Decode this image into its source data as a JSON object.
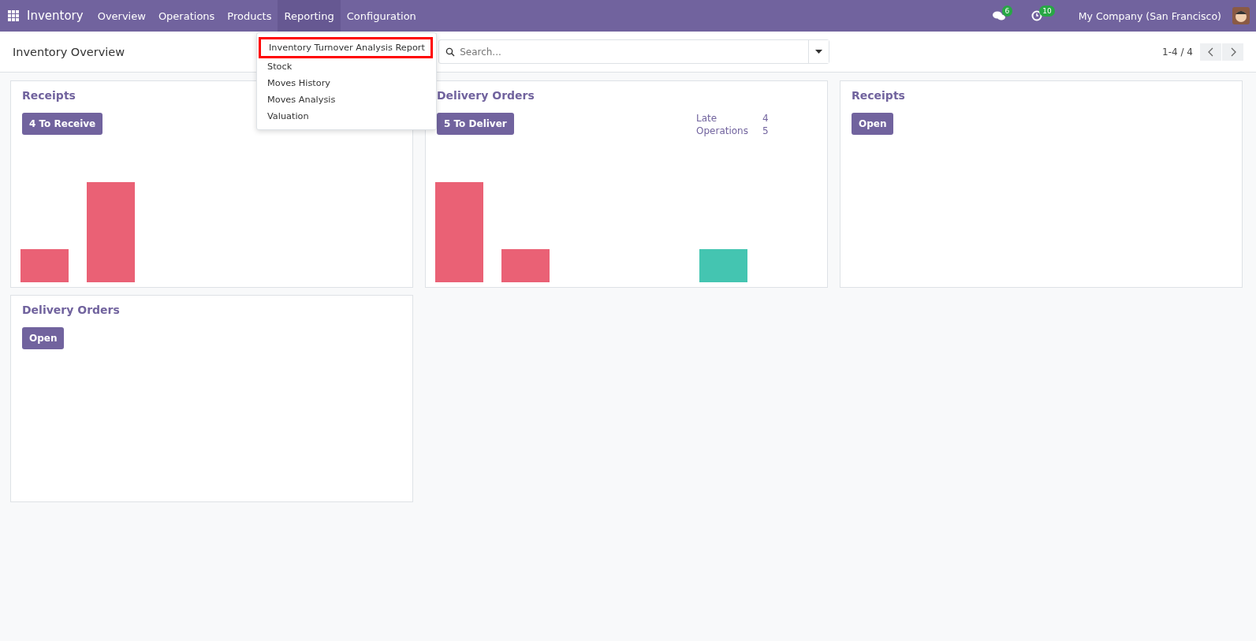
{
  "navbar": {
    "app_name": "Inventory",
    "menu": [
      {
        "label": "Overview",
        "selected": false
      },
      {
        "label": "Operations",
        "selected": false
      },
      {
        "label": "Products",
        "selected": false
      },
      {
        "label": "Reporting",
        "selected": true
      },
      {
        "label": "Configuration",
        "selected": false
      }
    ],
    "messages_count": "6",
    "activities_count": "10",
    "company": "My Company (San Francisco)"
  },
  "dropdown": {
    "items": [
      {
        "label": "Inventory Turnover Analysis Report",
        "highlighted": true
      },
      {
        "label": "Stock",
        "highlighted": false
      },
      {
        "label": "Moves History",
        "highlighted": false
      },
      {
        "label": "Moves Analysis",
        "highlighted": false
      },
      {
        "label": "Valuation",
        "highlighted": false
      }
    ]
  },
  "control_panel": {
    "title": "Inventory Overview",
    "search": {
      "placeholder": "Search..."
    },
    "pager": "1-4 / 4"
  },
  "cards": [
    {
      "title": "Receipts",
      "button": "4 To Receive",
      "graph": true
    },
    {
      "title": "Delivery Orders",
      "button": "5 To Deliver",
      "stats": [
        {
          "label": "Late",
          "value": "4"
        },
        {
          "label": "Operations",
          "value": "5"
        }
      ],
      "graph": true
    },
    {
      "title": "Receipts",
      "button": "Open",
      "graph": false
    },
    {
      "title": "Delivery Orders",
      "button": "Open",
      "graph": false
    }
  ]
}
